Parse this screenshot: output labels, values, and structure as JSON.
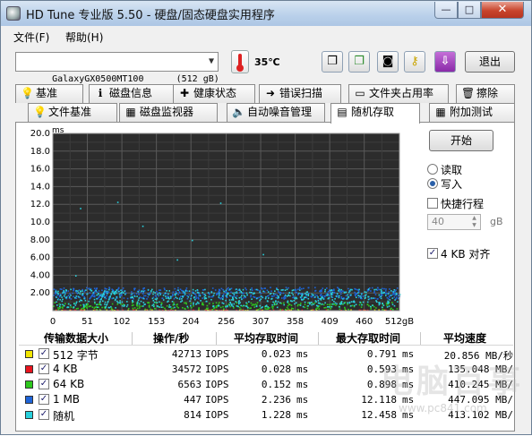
{
  "window": {
    "title": "HD Tune 专业版 5.50 - 硬盘/固态硬盘实用程序",
    "min_glyph": "—",
    "max_glyph": "□",
    "close_glyph": "✕"
  },
  "menu": {
    "file": "文件(F)",
    "help": "帮助(H)"
  },
  "toolbar": {
    "drive": "GalaxyGX0500MT100      (512 gB)",
    "drive_arrow": "▼",
    "temperature": "35℃",
    "exit_label": "退出",
    "copy_glyph": "❐",
    "copy2_glyph": "❐",
    "camera_glyph": "◙",
    "key_glyph": "⚷",
    "save_glyph": "⇩"
  },
  "tabs_row1": [
    {
      "label": "基准",
      "icon": "lightbulb-icon",
      "glyph": "💡"
    },
    {
      "label": "磁盘信息",
      "icon": "info-icon",
      "glyph": "ℹ"
    },
    {
      "label": "健康状态",
      "icon": "health-cross-icon",
      "glyph": "✚"
    },
    {
      "label": "错误扫描",
      "icon": "scan-icon",
      "glyph": "➜"
    },
    {
      "label": "文件夹占用率",
      "icon": "folder-icon",
      "glyph": "▭"
    },
    {
      "label": "擦除",
      "icon": "trash-icon",
      "glyph": "🗑"
    }
  ],
  "tabs_row2": [
    {
      "label": "文件基准",
      "icon": "lightbulb-icon",
      "glyph": "💡"
    },
    {
      "label": "磁盘监视器",
      "icon": "monitor-chart-icon",
      "glyph": "▦"
    },
    {
      "label": "自动噪音管理",
      "icon": "speaker-icon",
      "glyph": "🔈"
    },
    {
      "label": "随机存取",
      "icon": "random-access-icon",
      "glyph": "▤"
    },
    {
      "label": "附加测试",
      "icon": "extra-tests-icon",
      "glyph": "▦"
    }
  ],
  "controls": {
    "start_label": "开始",
    "read_label": "读取",
    "write_label": "写入",
    "selected_mode": "write",
    "quick_label": "快捷行程",
    "quick_checked": false,
    "gb_value": "40",
    "gb_unit": "gB",
    "align_label": "4 KB 对齐",
    "align_checked": true,
    "check_glyph": "✓"
  },
  "table": {
    "headers": [
      "传输数据大小",
      "操作/秒",
      "平均存取时间",
      "最大存取时间",
      "平均速度"
    ],
    "rows": [
      {
        "name": "512 字节",
        "color": "#f2e600",
        "ops": "42713",
        "ops_unit": "IOPS",
        "avg": "0.023",
        "avg_unit": "ms",
        "max": "0.791",
        "max_unit": "ms",
        "speed": "20.856 MB/秒"
      },
      {
        "name": "4 KB",
        "color": "#e8141e",
        "ops": "34572",
        "ops_unit": "IOPS",
        "avg": "0.028",
        "avg_unit": "ms",
        "max": "0.593",
        "max_unit": "ms",
        "speed": "135.048 MB/"
      },
      {
        "name": "64 KB",
        "color": "#2ec81e",
        "ops": "6563",
        "ops_unit": "IOPS",
        "avg": "0.152",
        "avg_unit": "ms",
        "max": "0.898",
        "max_unit": "ms",
        "speed": "410.245 MB/"
      },
      {
        "name": "1 MB",
        "color": "#1e64d8",
        "ops": "447",
        "ops_unit": "IOPS",
        "avg": "2.236",
        "avg_unit": "ms",
        "max": "12.118",
        "max_unit": "ms",
        "speed": "447.095 MB/"
      },
      {
        "name": "随机",
        "color": "#28d0dc",
        "ops": "814",
        "ops_unit": "IOPS",
        "avg": "1.228",
        "avg_unit": "ms",
        "max": "12.458",
        "max_unit": "ms",
        "speed": "413.102 MB/"
      }
    ]
  },
  "watermark": {
    "text": "电脑百事",
    "url": "www.pc841.com"
  },
  "chart_data": {
    "type": "scatter",
    "ylabel": "ms",
    "y_ticks": [
      "20.0",
      "18.0",
      "16.0",
      "14.0",
      "12.0",
      "10.0",
      "8.00",
      "6.00",
      "4.00",
      "2.00"
    ],
    "x_ticks": [
      "0",
      "51",
      "102",
      "153",
      "204",
      "256",
      "307",
      "358",
      "409",
      "460",
      "512gB"
    ],
    "ylim": [
      0,
      20
    ],
    "xlim": [
      0,
      512
    ],
    "grid": true,
    "background": "#2c2c2c",
    "series": [
      {
        "name": "512 字节",
        "color": "#f2e600",
        "band": [
          0.0,
          0.05
        ]
      },
      {
        "name": "4 KB",
        "color": "#e8141e",
        "band": [
          0.0,
          0.05
        ]
      },
      {
        "name": "64 KB",
        "color": "#2ec81e",
        "band": [
          0.1,
          0.9
        ]
      },
      {
        "name": "1 MB",
        "color": "#1e64d8",
        "band": [
          1.3,
          2.6
        ]
      },
      {
        "name": "随机",
        "color": "#28d0dc",
        "band": [
          0.3,
          2.4
        ]
      }
    ]
  }
}
